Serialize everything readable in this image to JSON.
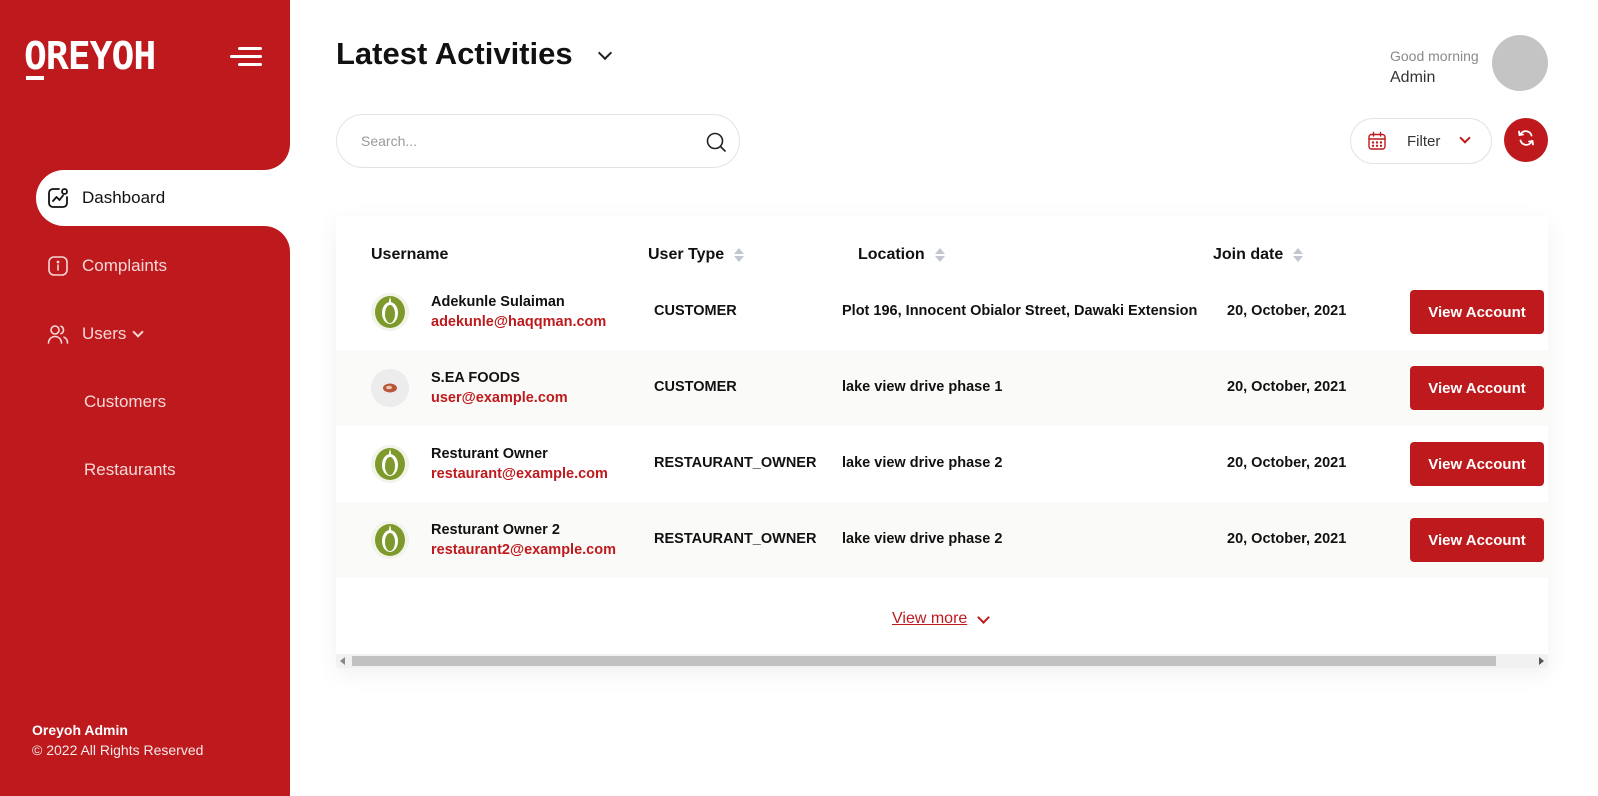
{
  "sidebar": {
    "logo": "OREYOH",
    "items": [
      {
        "label": "Dashboard",
        "icon": "chart-activity-icon",
        "active": true
      },
      {
        "label": "Complaints",
        "icon": "info-icon"
      },
      {
        "label": "Users",
        "icon": "users-icon"
      }
    ],
    "sub_items": [
      {
        "label": "Customers"
      },
      {
        "label": "Restaurants"
      }
    ],
    "footer": {
      "brand": "Oreyoh Admin",
      "copyright": "© 2022 All Rights Reserved"
    }
  },
  "header": {
    "title": "Latest Activities",
    "greeting": "Good morning",
    "user_name": "Admin"
  },
  "search": {
    "placeholder": "Search..."
  },
  "filter": {
    "label": "Filter"
  },
  "table": {
    "columns": [
      "Username",
      "User Type",
      "Location",
      "Join date"
    ],
    "rows": [
      {
        "name": "Adekunle Sulaiman",
        "email": "adekunle@haqqman.com",
        "type": "CUSTOMER",
        "location": "Plot 196, Innocent Obialor Street, Dawaki Extension",
        "join_date": "20, October, 2021",
        "action": "View Account",
        "avatar": "leaf-logo"
      },
      {
        "name": "S.EA FOODS",
        "email": "user@example.com",
        "type": "CUSTOMER",
        "location": "lake view drive phase 1",
        "join_date": "20, October, 2021",
        "action": "View Account",
        "avatar": "food-logo"
      },
      {
        "name": "Resturant Owner",
        "email": "restaurant@example.com",
        "type": "RESTAURANT_OWNER",
        "location": "lake view drive phase 2",
        "join_date": "20, October, 2021",
        "action": "View Account",
        "avatar": "leaf-logo"
      },
      {
        "name": "Resturant Owner 2",
        "email": "restaurant2@example.com",
        "type": "RESTAURANT_OWNER",
        "location": "lake view drive phase 2",
        "join_date": "20, October, 2021",
        "action": "View Account",
        "avatar": "leaf-logo"
      }
    ],
    "view_more": "View more"
  },
  "colors": {
    "brand": "#be1a1d",
    "avatar_green": "#7f9a2c"
  }
}
